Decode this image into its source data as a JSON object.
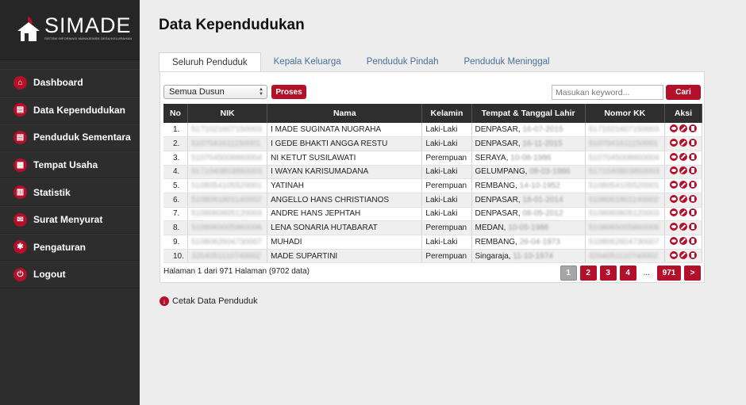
{
  "app": {
    "logo_text": "SIMADE",
    "logo_subtitle": "SISTEM INFORMASI MANAJEMEN DESA/KELURAHAN",
    "logo_icon": "house-flame-logo"
  },
  "sidebar": {
    "items": [
      {
        "label": "Dashboard",
        "icon": "home-icon"
      },
      {
        "label": "Data Kependudukan",
        "icon": "people-card-icon"
      },
      {
        "label": "Penduduk Sementara",
        "icon": "people-card-icon"
      },
      {
        "label": "Tempat Usaha",
        "icon": "building-icon"
      },
      {
        "label": "Statistik",
        "icon": "chart-icon"
      },
      {
        "label": "Surat Menyurat",
        "icon": "letter-icon"
      },
      {
        "label": "Pengaturan",
        "icon": "gear-icon"
      },
      {
        "label": "Logout",
        "icon": "power-icon"
      }
    ]
  },
  "page": {
    "title": "Data Kependudukan"
  },
  "tabs": [
    {
      "label": "Seluruh Penduduk",
      "active": true
    },
    {
      "label": "Kepala Keluarga",
      "active": false
    },
    {
      "label": "Penduduk Pindah",
      "active": false
    },
    {
      "label": "Penduduk Meninggal",
      "active": false
    }
  ],
  "toolbar": {
    "dusun_selected": "Semua Dusun",
    "proses_label": "Proses",
    "search_placeholder": "Masukan keyword...",
    "cari_label": "Cari"
  },
  "table": {
    "headers": [
      "No",
      "NIK",
      "Nama",
      "Kelamin",
      "Tempat & Tanggal Lahir",
      "Nomor KK",
      "Aksi"
    ],
    "rows": [
      {
        "no": "1.",
        "nik": "5171021607150003",
        "nama": "I MADE SUGINATA NUGRAHA",
        "kelamin": "Laki-Laki",
        "tempat": "DENPASAR,",
        "tanggal": "16-07-2015",
        "kk": "5171021607150003"
      },
      {
        "no": "2.",
        "nik": "5107041611150001",
        "nama": "I GEDE BHAKTI ANGGA RESTU",
        "kelamin": "Laki-Laki",
        "tempat": "DENPASAR,",
        "tanggal": "16-11-2015",
        "kk": "5107041611150001"
      },
      {
        "no": "3.",
        "nik": "5107045008860004",
        "nama": "NI KETUT SUSILAWATI",
        "kelamin": "Perempuan",
        "tempat": "SERAYA,",
        "tanggal": "10-08-1986",
        "kk": "5107045008860004"
      },
      {
        "no": "4.",
        "nik": "5171040803860003",
        "nama": "I WAYAN KARISUMADANA",
        "kelamin": "Laki-Laki",
        "tempat": "GELUMPANG,",
        "tanggal": "08-03-1986",
        "kk": "5171040803860003"
      },
      {
        "no": "5.",
        "nik": "5108054105520001",
        "nama": "YATINAH",
        "kelamin": "Perempuan",
        "tempat": "REMBANG,",
        "tanggal": "14-10-1952",
        "kk": "5108054105520001"
      },
      {
        "no": "6.",
        "nik": "5108061801140002",
        "nama": "ANGELLO HANS CHRISTIANOS",
        "kelamin": "Laki-Laki",
        "tempat": "DENPASAR,",
        "tanggal": "18-01-2014",
        "kk": "5108061801140002"
      },
      {
        "no": "7.",
        "nik": "5108060805120003",
        "nama": "ANDRE HANS JEPHTAH",
        "kelamin": "Laki-Laki",
        "tempat": "DENPASAR,",
        "tanggal": "08-05-2012",
        "kk": "5108060805120003"
      },
      {
        "no": "8.",
        "nik": "5108065005860006",
        "nama": "LENA SONARIA HUTABARAT",
        "kelamin": "Perempuan",
        "tempat": "MEDAN,",
        "tanggal": "10-05-1986",
        "kk": "5108065005860006"
      },
      {
        "no": "9.",
        "nik": "5108062604730007",
        "nama": "MUHADI",
        "kelamin": "Laki-Laki",
        "tempat": "REMBANG,",
        "tanggal": "26-04-1973",
        "kk": "5108062604730007"
      },
      {
        "no": "10.",
        "nik": "3204051110740002",
        "nama": "MADE SUPARTINI",
        "kelamin": "Perempuan",
        "tempat": "Singaraja,",
        "tanggal": "11-10-1974",
        "kk": "3204051110740002"
      }
    ]
  },
  "footer": {
    "info": "Halaman 1 dari 971 Halaman (9702 data)",
    "pages": [
      "1",
      "2",
      "3",
      "4"
    ],
    "dots": "...",
    "last_page": "971",
    "next": ">"
  },
  "cetak": {
    "label": "Cetak Data Penduduk",
    "icon": "download-icon"
  },
  "colors": {
    "accent": "#b3102a",
    "sidebar_bg": "#2d2d2d",
    "table_header_bg": "#2e2e2e"
  }
}
